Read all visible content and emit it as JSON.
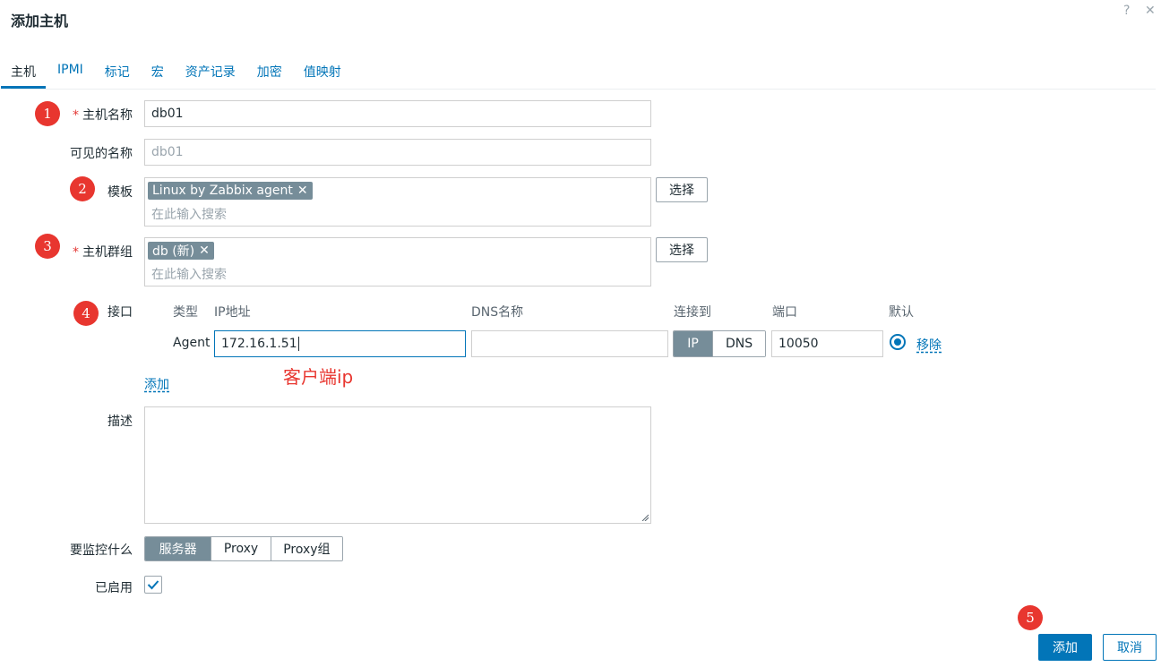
{
  "dialog": {
    "title": "添加主机",
    "help_icon": "?",
    "close_icon": "✕"
  },
  "tabs": [
    {
      "label": "主机"
    },
    {
      "label": "IPMI"
    },
    {
      "label": "标记"
    },
    {
      "label": "宏"
    },
    {
      "label": "资产记录"
    },
    {
      "label": "加密"
    },
    {
      "label": "值映射"
    }
  ],
  "form": {
    "hostname": {
      "label": "主机名称",
      "value": "db01"
    },
    "visible_name": {
      "label": "可见的名称",
      "placeholder": "db01"
    },
    "templates": {
      "label": "模板",
      "chips": [
        "Linux by Zabbix agent"
      ],
      "search_placeholder": "在此输入搜索",
      "select_label": "选择"
    },
    "host_groups": {
      "label": "主机群组",
      "chips": [
        "db (新)"
      ],
      "search_placeholder": "在此输入搜索",
      "select_label": "选择"
    },
    "interfaces": {
      "label": "接口",
      "headers": {
        "type": "类型",
        "ip": "IP地址",
        "dns": "DNS名称",
        "connect": "连接到",
        "port": "端口",
        "default": "默认"
      },
      "rows": [
        {
          "type": "Agent",
          "ip": "172.16.1.51",
          "dns": "",
          "connect_ip": "IP",
          "connect_dns": "DNS",
          "port": "10050",
          "remove": "移除"
        }
      ],
      "add_label": "添加"
    },
    "description": {
      "label": "描述"
    },
    "monitored_by": {
      "label": "要监控什么",
      "options": [
        "服务器",
        "Proxy",
        "Proxy组"
      ]
    },
    "enabled": {
      "label": "已启用",
      "checked": true
    }
  },
  "annotations": {
    "badges": [
      "1",
      "2",
      "3",
      "4",
      "5"
    ],
    "client_ip_note": "客户端ip"
  },
  "footer": {
    "add_label": "添加",
    "cancel_label": "取消"
  },
  "colors": {
    "accent": "#0275b8",
    "badge": "#e8362f",
    "chip": "#768d99"
  }
}
